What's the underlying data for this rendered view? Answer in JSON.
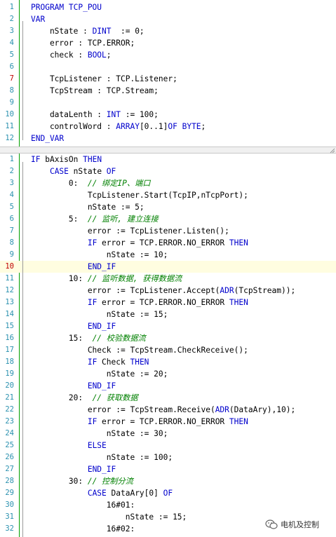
{
  "declaration": {
    "lines": [
      {
        "n": "1",
        "parts": [
          {
            "t": "PROGRAM TCP_POU",
            "c": "kw"
          }
        ]
      },
      {
        "n": "2",
        "parts": [
          {
            "t": "VAR",
            "c": "kw"
          }
        ]
      },
      {
        "n": "3",
        "parts": [
          {
            "t": "    nState : "
          },
          {
            "t": "DINT",
            "c": "ty"
          },
          {
            "t": "  := 0;"
          }
        ]
      },
      {
        "n": "4",
        "parts": [
          {
            "t": "    error : TCP.ERROR;"
          }
        ]
      },
      {
        "n": "5",
        "parts": [
          {
            "t": "    check : "
          },
          {
            "t": "BOOL",
            "c": "ty"
          },
          {
            "t": ";"
          }
        ]
      },
      {
        "n": "6",
        "parts": []
      },
      {
        "n": "7",
        "red": true,
        "parts": [
          {
            "t": "    TcpListener : TCP.Listener;"
          }
        ]
      },
      {
        "n": "8",
        "parts": [
          {
            "t": "    TcpStream : TCP.Stream;"
          }
        ]
      },
      {
        "n": "9",
        "parts": []
      },
      {
        "n": "10",
        "parts": [
          {
            "t": "    dataLenth : "
          },
          {
            "t": "INT",
            "c": "ty"
          },
          {
            "t": " := 100;"
          }
        ]
      },
      {
        "n": "11",
        "parts": [
          {
            "t": "    controlWord : "
          },
          {
            "t": "ARRAY",
            "c": "ty"
          },
          {
            "t": "[0..1]"
          },
          {
            "t": "OF",
            "c": "kw"
          },
          {
            "t": " "
          },
          {
            "t": "BYTE",
            "c": "ty"
          },
          {
            "t": ";"
          }
        ]
      },
      {
        "n": "12",
        "parts": [
          {
            "t": "END_VAR",
            "c": "kw"
          }
        ]
      }
    ]
  },
  "implementation": {
    "lines": [
      {
        "n": "1",
        "parts": [
          {
            "t": "IF",
            "c": "kw"
          },
          {
            "t": " bAxisOn "
          },
          {
            "t": "THEN",
            "c": "kw"
          }
        ]
      },
      {
        "n": "2",
        "parts": [
          {
            "t": "    "
          },
          {
            "t": "CASE",
            "c": "kw"
          },
          {
            "t": " nState "
          },
          {
            "t": "OF",
            "c": "kw"
          }
        ]
      },
      {
        "n": "3",
        "parts": [
          {
            "t": "        0:  "
          },
          {
            "t": "// 绑定IP、端口",
            "c": "cm"
          }
        ]
      },
      {
        "n": "4",
        "parts": [
          {
            "t": "            TcpListener.Start(TcpIP,nTcpPort);"
          }
        ]
      },
      {
        "n": "5",
        "parts": [
          {
            "t": "            nState := 5;"
          }
        ]
      },
      {
        "n": "6",
        "parts": [
          {
            "t": "        5:  "
          },
          {
            "t": "// 监听, 建立连接",
            "c": "cm"
          }
        ]
      },
      {
        "n": "7",
        "parts": [
          {
            "t": "            error := TcpListener.Listen();"
          }
        ]
      },
      {
        "n": "8",
        "parts": [
          {
            "t": "            "
          },
          {
            "t": "IF",
            "c": "kw"
          },
          {
            "t": " error = TCP.ERROR.NO_ERROR "
          },
          {
            "t": "THEN",
            "c": "kw"
          }
        ]
      },
      {
        "n": "9",
        "parts": [
          {
            "t": "                nState := 10;"
          }
        ]
      },
      {
        "n": "10",
        "red": true,
        "hl": true,
        "parts": [
          {
            "t": "            "
          },
          {
            "t": "END_IF",
            "c": "kw"
          }
        ]
      },
      {
        "n": "11",
        "parts": [
          {
            "t": "        10: "
          },
          {
            "t": "// 监听数据, 获得数据流",
            "c": "cm"
          }
        ]
      },
      {
        "n": "12",
        "parts": [
          {
            "t": "            error := TcpListener.Accept("
          },
          {
            "t": "ADR",
            "c": "kw"
          },
          {
            "t": "(TcpStream));"
          }
        ]
      },
      {
        "n": "13",
        "parts": [
          {
            "t": "            "
          },
          {
            "t": "IF",
            "c": "kw"
          },
          {
            "t": " error = TCP.ERROR.NO_ERROR "
          },
          {
            "t": "THEN",
            "c": "kw"
          }
        ]
      },
      {
        "n": "14",
        "parts": [
          {
            "t": "                nState := 15;"
          }
        ]
      },
      {
        "n": "15",
        "parts": [
          {
            "t": "            "
          },
          {
            "t": "END_IF",
            "c": "kw"
          }
        ]
      },
      {
        "n": "16",
        "parts": [
          {
            "t": "        15:  "
          },
          {
            "t": "// 校验数据流",
            "c": "cm"
          }
        ]
      },
      {
        "n": "17",
        "parts": [
          {
            "t": "            Check := TcpStream.CheckReceive();"
          }
        ]
      },
      {
        "n": "18",
        "parts": [
          {
            "t": "            "
          },
          {
            "t": "IF",
            "c": "kw"
          },
          {
            "t": " Check "
          },
          {
            "t": "THEN",
            "c": "kw"
          }
        ]
      },
      {
        "n": "19",
        "parts": [
          {
            "t": "                nState := 20;"
          }
        ]
      },
      {
        "n": "20",
        "parts": [
          {
            "t": "            "
          },
          {
            "t": "END_IF",
            "c": "kw"
          }
        ]
      },
      {
        "n": "21",
        "parts": [
          {
            "t": "        20:  "
          },
          {
            "t": "// 获取数据",
            "c": "cm"
          }
        ]
      },
      {
        "n": "22",
        "parts": [
          {
            "t": "            error := TcpStream.Receive("
          },
          {
            "t": "ADR",
            "c": "kw"
          },
          {
            "t": "(DataAry),10);"
          }
        ]
      },
      {
        "n": "23",
        "parts": [
          {
            "t": "            "
          },
          {
            "t": "IF",
            "c": "kw"
          },
          {
            "t": " error = TCP.ERROR.NO_ERROR "
          },
          {
            "t": "THEN",
            "c": "kw"
          }
        ]
      },
      {
        "n": "24",
        "parts": [
          {
            "t": "                nState := 30;"
          }
        ]
      },
      {
        "n": "25",
        "parts": [
          {
            "t": "            "
          },
          {
            "t": "ELSE",
            "c": "kw"
          }
        ]
      },
      {
        "n": "26",
        "parts": [
          {
            "t": "                nState := 100;"
          }
        ]
      },
      {
        "n": "27",
        "parts": [
          {
            "t": "            "
          },
          {
            "t": "END_IF",
            "c": "kw"
          }
        ]
      },
      {
        "n": "28",
        "parts": [
          {
            "t": "        30: "
          },
          {
            "t": "// 控制分流",
            "c": "cm"
          }
        ]
      },
      {
        "n": "29",
        "parts": [
          {
            "t": "            "
          },
          {
            "t": "CASE",
            "c": "kw"
          },
          {
            "t": " DataAry[0] "
          },
          {
            "t": "OF",
            "c": "kw"
          }
        ]
      },
      {
        "n": "30",
        "parts": [
          {
            "t": "                16#01:"
          }
        ]
      },
      {
        "n": "31",
        "parts": [
          {
            "t": "                    nState := 15;"
          }
        ]
      },
      {
        "n": "32",
        "parts": [
          {
            "t": "                16#02:"
          }
        ]
      }
    ]
  },
  "watermark": {
    "text": "电机及控制",
    "icon": "wechat-icon"
  }
}
